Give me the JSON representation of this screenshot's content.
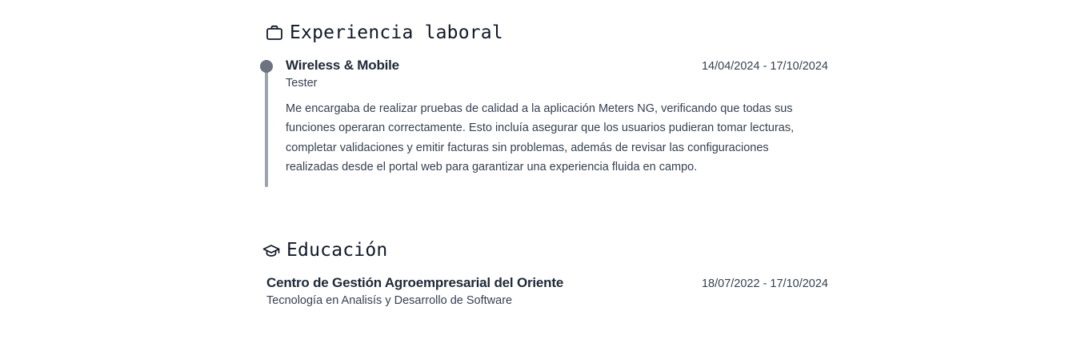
{
  "experience": {
    "title": "Experiencia laboral",
    "icon": "briefcase-icon",
    "items": [
      {
        "company": "Wireless & Mobile",
        "dates": "14/04/2024 - 17/10/2024",
        "role": "Tester",
        "description": "Me encargaba de realizar pruebas de calidad a la aplicación Meters NG, verificando que todas sus funciones operaran correctamente. Esto incluía asegurar que los usuarios pudieran tomar lecturas, completar validaciones y emitir facturas sin problemas, además de revisar las configuraciones realizadas desde el portal web para garantizar una experiencia fluida en campo."
      }
    ]
  },
  "education": {
    "title": "Educación",
    "icon": "graduation-cap-icon",
    "items": [
      {
        "institution": "Centro de Gestión Agroempresarial del Oriente",
        "dates": "18/07/2022 - 17/10/2024",
        "program": "Tecnología en Analisís y Desarrollo de Software"
      }
    ]
  },
  "colors": {
    "timeline_line": "#9ca3af",
    "timeline_dot": "#6b7280",
    "text_primary": "#1f2937",
    "text_secondary": "#374151"
  }
}
